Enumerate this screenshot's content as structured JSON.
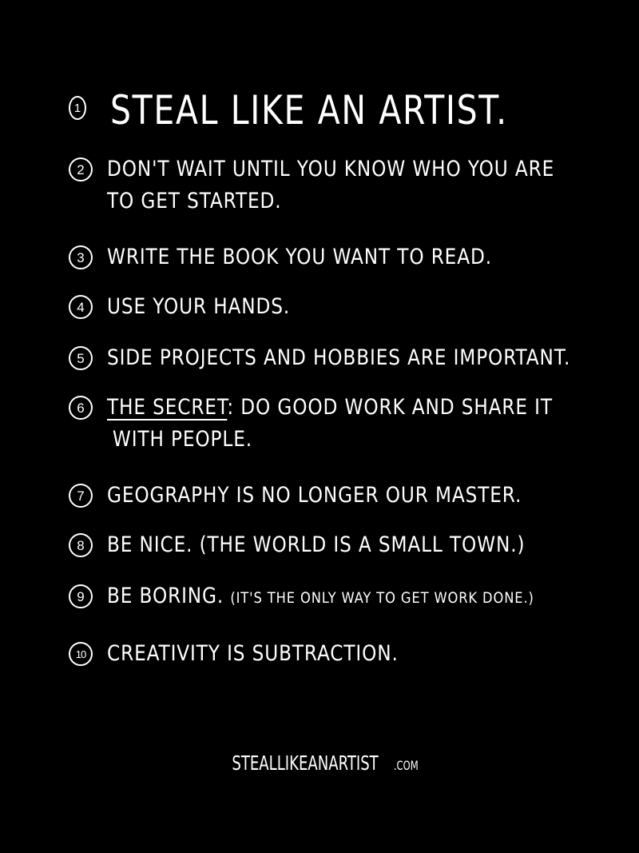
{
  "rules": [
    {
      "number": "1",
      "text": "Steal like an artist."
    },
    {
      "number": "2",
      "line1": "Don't wait until you know who you are",
      "line2": "to get started."
    },
    {
      "number": "3",
      "text": "Write the book you want to read."
    },
    {
      "number": "4",
      "text": "Use your hands."
    },
    {
      "number": "5",
      "text": "Side projects and hobbies are important."
    },
    {
      "number": "6",
      "highlight": "The secret",
      "rest": ": do good work and share it",
      "line2": "with people."
    },
    {
      "number": "7",
      "text": "Geography is no longer our master."
    },
    {
      "number": "8",
      "text": "Be nice. (The world is a small town.)"
    },
    {
      "number": "9",
      "main": "Be boring.",
      "aside": "(It's the only way to get work done.)"
    },
    {
      "number": "10",
      "text": "Creativity is subtraction."
    }
  ],
  "footer": {
    "site": "StealLikeAnArtist",
    "tld": ".com"
  }
}
